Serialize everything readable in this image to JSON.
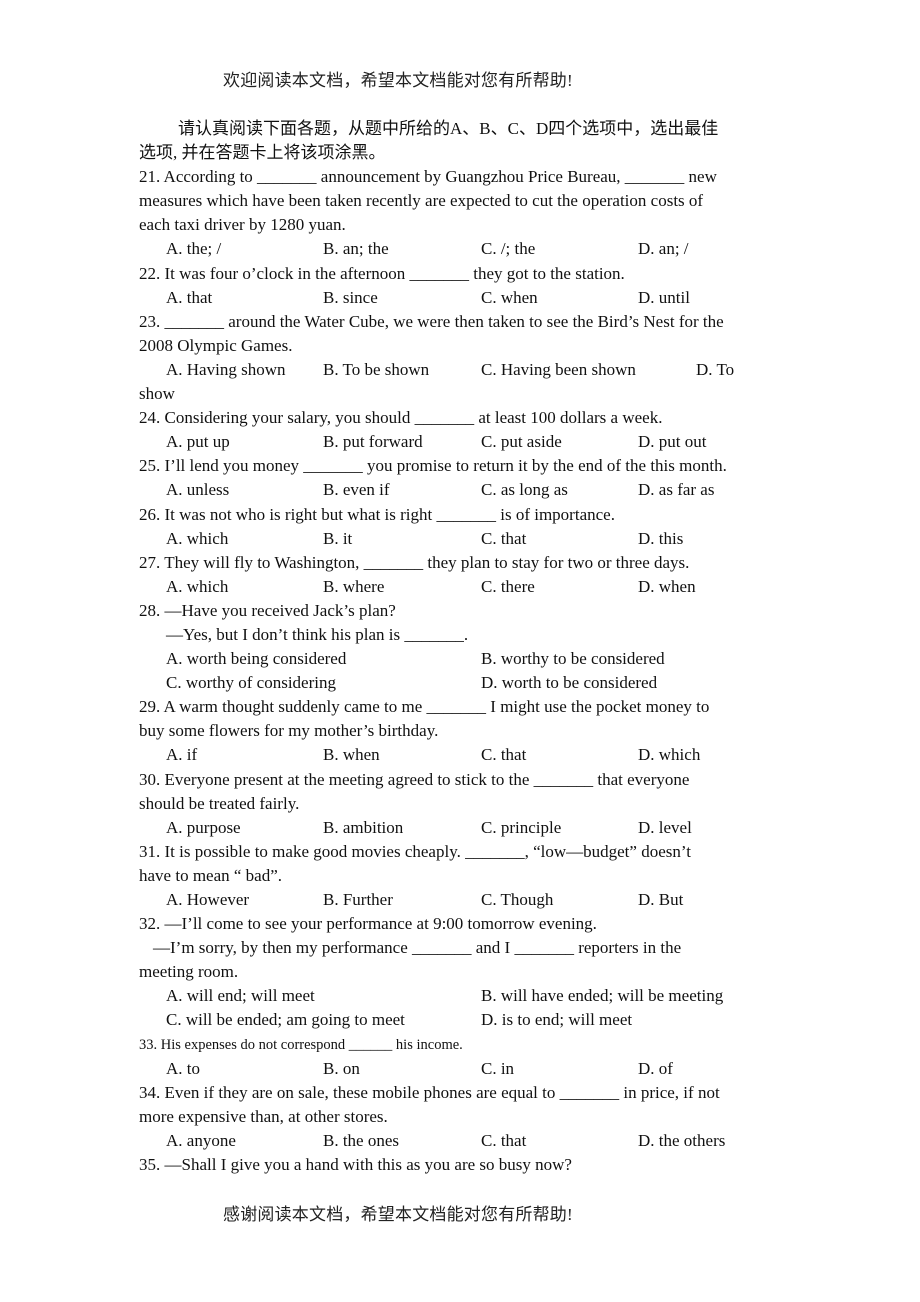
{
  "header": "欢迎阅读本文档，希望本文档能对您有所帮助!",
  "footer": "感谢阅读本文档，希望本文档能对您有所帮助!",
  "instructions": {
    "line1": "请认真阅读下面各题，从题中所给的A、B、C、D四个选项中，选出最佳",
    "line2": "选项, 并在答题卡上将该项涂黑。"
  },
  "questions": [
    {
      "number": "21",
      "lines": [
        "21. According to _______ announcement by Guangzhou Price Bureau, _______ new",
        "measures which have been taken recently are expected to cut the operation costs of",
        "each taxi driver by 1280 yuan."
      ],
      "options": [
        "A. the; /",
        "B. an; the",
        "C. /; the",
        "D. an; /"
      ]
    },
    {
      "number": "22",
      "lines": [
        "22. It was four o’clock in the afternoon _______ they got to the station."
      ],
      "options": [
        "A. that",
        "B. since",
        "C. when",
        "D. until"
      ]
    },
    {
      "number": "23",
      "lines": [
        "23. _______ around the Water Cube, we were then taken to see the Bird’s Nest for the",
        "2008 Olympic Games."
      ],
      "options": [
        "A. Having shown",
        "B. To be shown",
        "C. Having been shown",
        "D. To"
      ],
      "overflow": "show"
    },
    {
      "number": "24",
      "lines": [
        "24. Considering your salary, you should _______ at least 100 dollars a week."
      ],
      "options": [
        "A. put up",
        "B. put forward",
        "C. put aside",
        "D. put out"
      ]
    },
    {
      "number": "25",
      "lines": [
        "25. I’ll lend you money _______ you promise to return it by the end of the this month."
      ],
      "options": [
        "A. unless",
        "B. even if",
        "C. as long as",
        "D. as far as"
      ]
    },
    {
      "number": "26",
      "lines": [
        "26. It was not who is right but what is right _______ is of importance."
      ],
      "options": [
        "A. which",
        "B. it",
        "C. that",
        "D. this"
      ]
    },
    {
      "number": "27",
      "lines": [
        "27. They will fly to Washington, _______ they plan to stay for two or three days."
      ],
      "options": [
        "A. which",
        "B. where",
        "C. there",
        "D. when"
      ]
    },
    {
      "number": "28",
      "lines": [
        "28. —Have you received Jack’s plan?",
        "—Yes, but I don’t think his plan is _______."
      ],
      "options": [
        "A. worth being considered",
        "B. worthy to be considered",
        "C. worthy of considering",
        "D. worth to be considered"
      ]
    },
    {
      "number": "29",
      "lines": [
        "29. A warm thought suddenly came to me _______ I might use the pocket money to",
        "buy some flowers for my mother’s birthday."
      ],
      "options": [
        "A. if",
        "B. when",
        "C. that",
        "D. which"
      ]
    },
    {
      "number": "30",
      "lines": [
        "30. Everyone present at the meeting agreed to stick to the _______ that everyone",
        "should be treated fairly."
      ],
      "options": [
        "A. purpose",
        "B. ambition",
        "C. principle",
        "D. level"
      ]
    },
    {
      "number": "31",
      "lines": [
        "31. It is possible to make good movies cheaply. _______, “low—budget” doesn’t",
        "have to mean “ bad”."
      ],
      "options": [
        "A. However",
        "B. Further",
        "C. Though",
        "D. But"
      ]
    },
    {
      "number": "32",
      "lines": [
        "32. —I’ll come to see your performance at 9:00 tomorrow evening.",
        "—I’m sorry, by then my performance _______ and I _______ reporters in the",
        "meeting room."
      ],
      "options": [
        "A. will end; will meet",
        "B. will have ended; will be meeting",
        "C. will be ended; am going to meet",
        "D. is to end; will meet"
      ]
    },
    {
      "number": "33",
      "lines": [
        "33. His expenses do not correspond ______ his income."
      ],
      "options": [
        "A. to",
        "B. on",
        "C. in",
        "D. of"
      ]
    },
    {
      "number": "34",
      "lines": [
        "34. Even if they are on sale, these mobile phones are equal to _______ in price, if not",
        "more expensive than, at other stores."
      ],
      "options": [
        "A. anyone",
        "B. the ones",
        "C. that",
        "D. the others"
      ]
    },
    {
      "number": "35",
      "lines": [
        "35. —Shall I give you a hand with this as you are so busy now?"
      ],
      "options": []
    }
  ]
}
